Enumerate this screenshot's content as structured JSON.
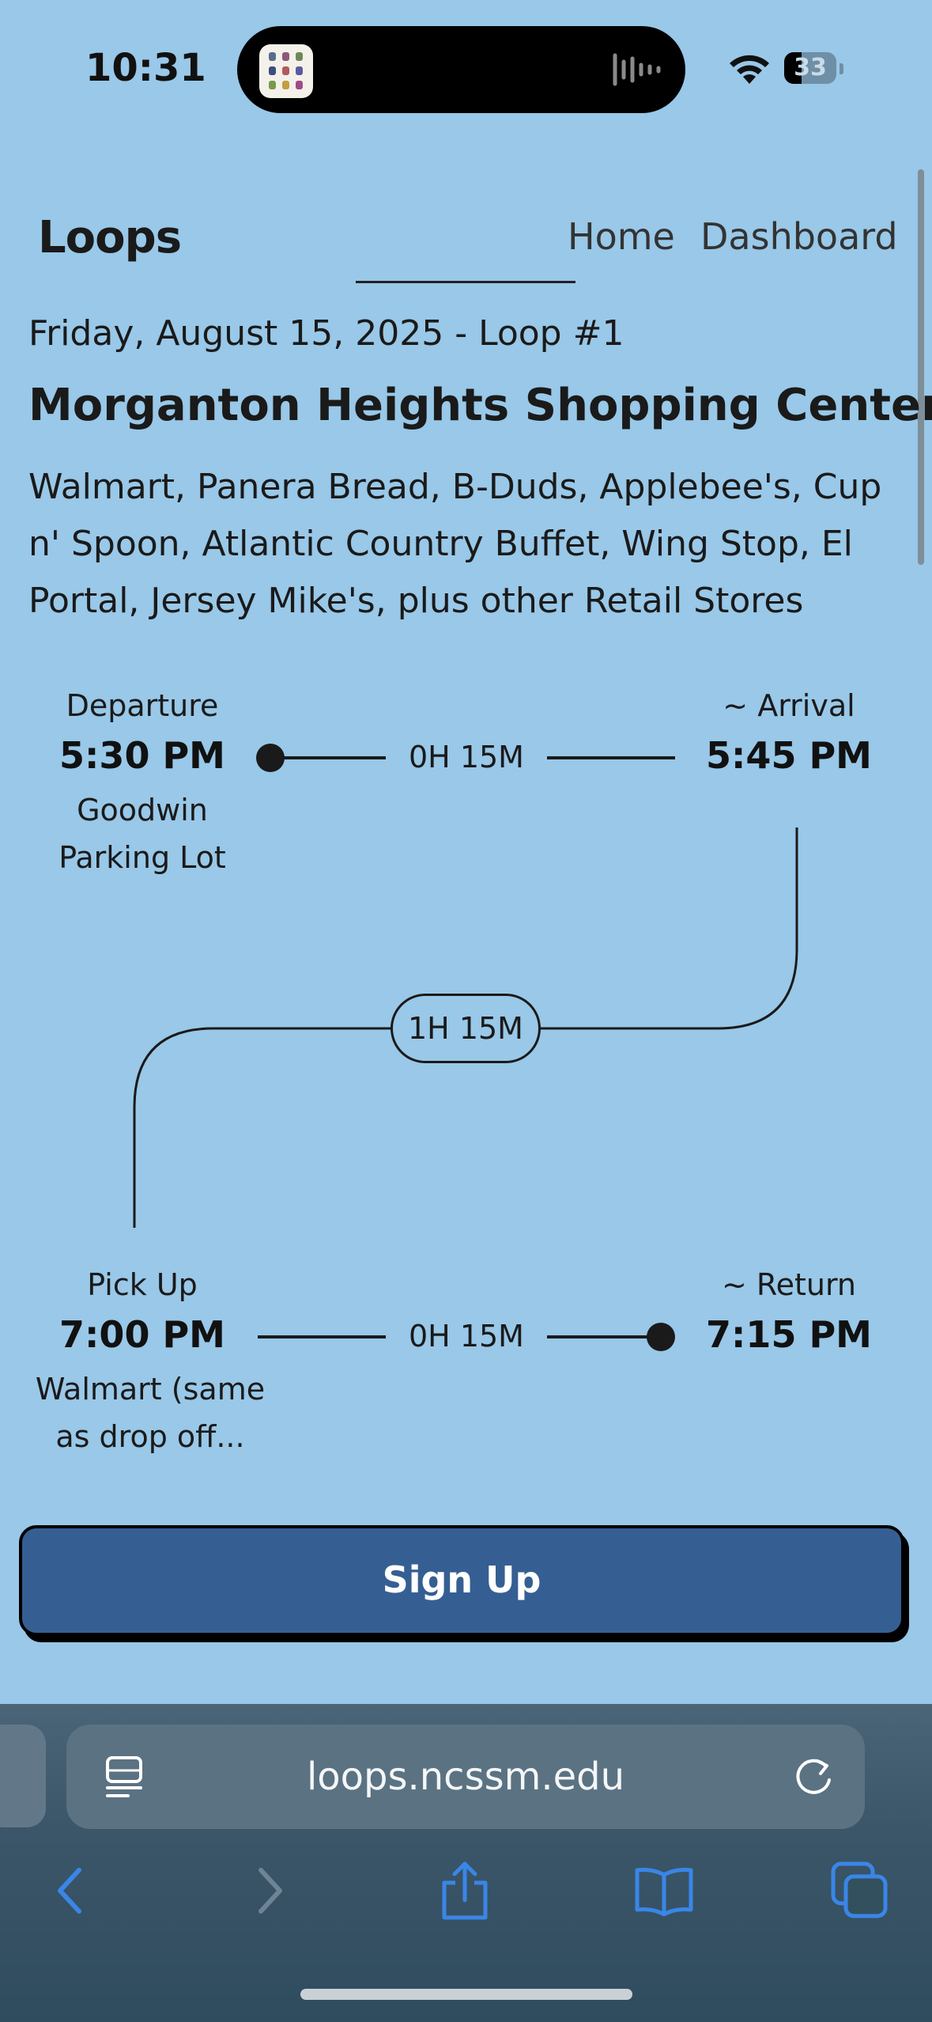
{
  "status_bar": {
    "time": "10:31",
    "battery": "33"
  },
  "header": {
    "logo": "Loops",
    "nav": {
      "home": "Home",
      "dashboard": "Dashboard"
    }
  },
  "trip": {
    "date_loop": "Friday, August 15, 2025 - Loop #1",
    "title": "Morganton Heights Shopping Center",
    "stores": "Walmart, Panera Bread, B-Duds, Applebee's, Cup n' Spoon, Atlantic Country Buffet, Wing Stop, El Portal, Jersey Mike's, plus other Retail Stores"
  },
  "timeline": {
    "departure": {
      "label": "Departure",
      "time": "5:30 PM",
      "place_line1": "Goodwin",
      "place_line2": "Parking Lot"
    },
    "arrival": {
      "label": "~ Arrival",
      "time": "5:45 PM"
    },
    "outbound_duration": "0H 15M",
    "stay_duration": "1H 15M",
    "pickup": {
      "label": "Pick Up",
      "time": "7:00 PM",
      "place_line1": "Walmart (same",
      "place_line2": "as drop off..."
    },
    "return": {
      "label": "~ Return",
      "time": "7:15 PM"
    },
    "return_duration": "0H 15M"
  },
  "actions": {
    "signup": "Sign Up"
  },
  "browser": {
    "url": "loops.ncssm.edu"
  },
  "colors": {
    "background": "#99c8e8",
    "button": "#355f93",
    "accent": "#3a86e8"
  }
}
